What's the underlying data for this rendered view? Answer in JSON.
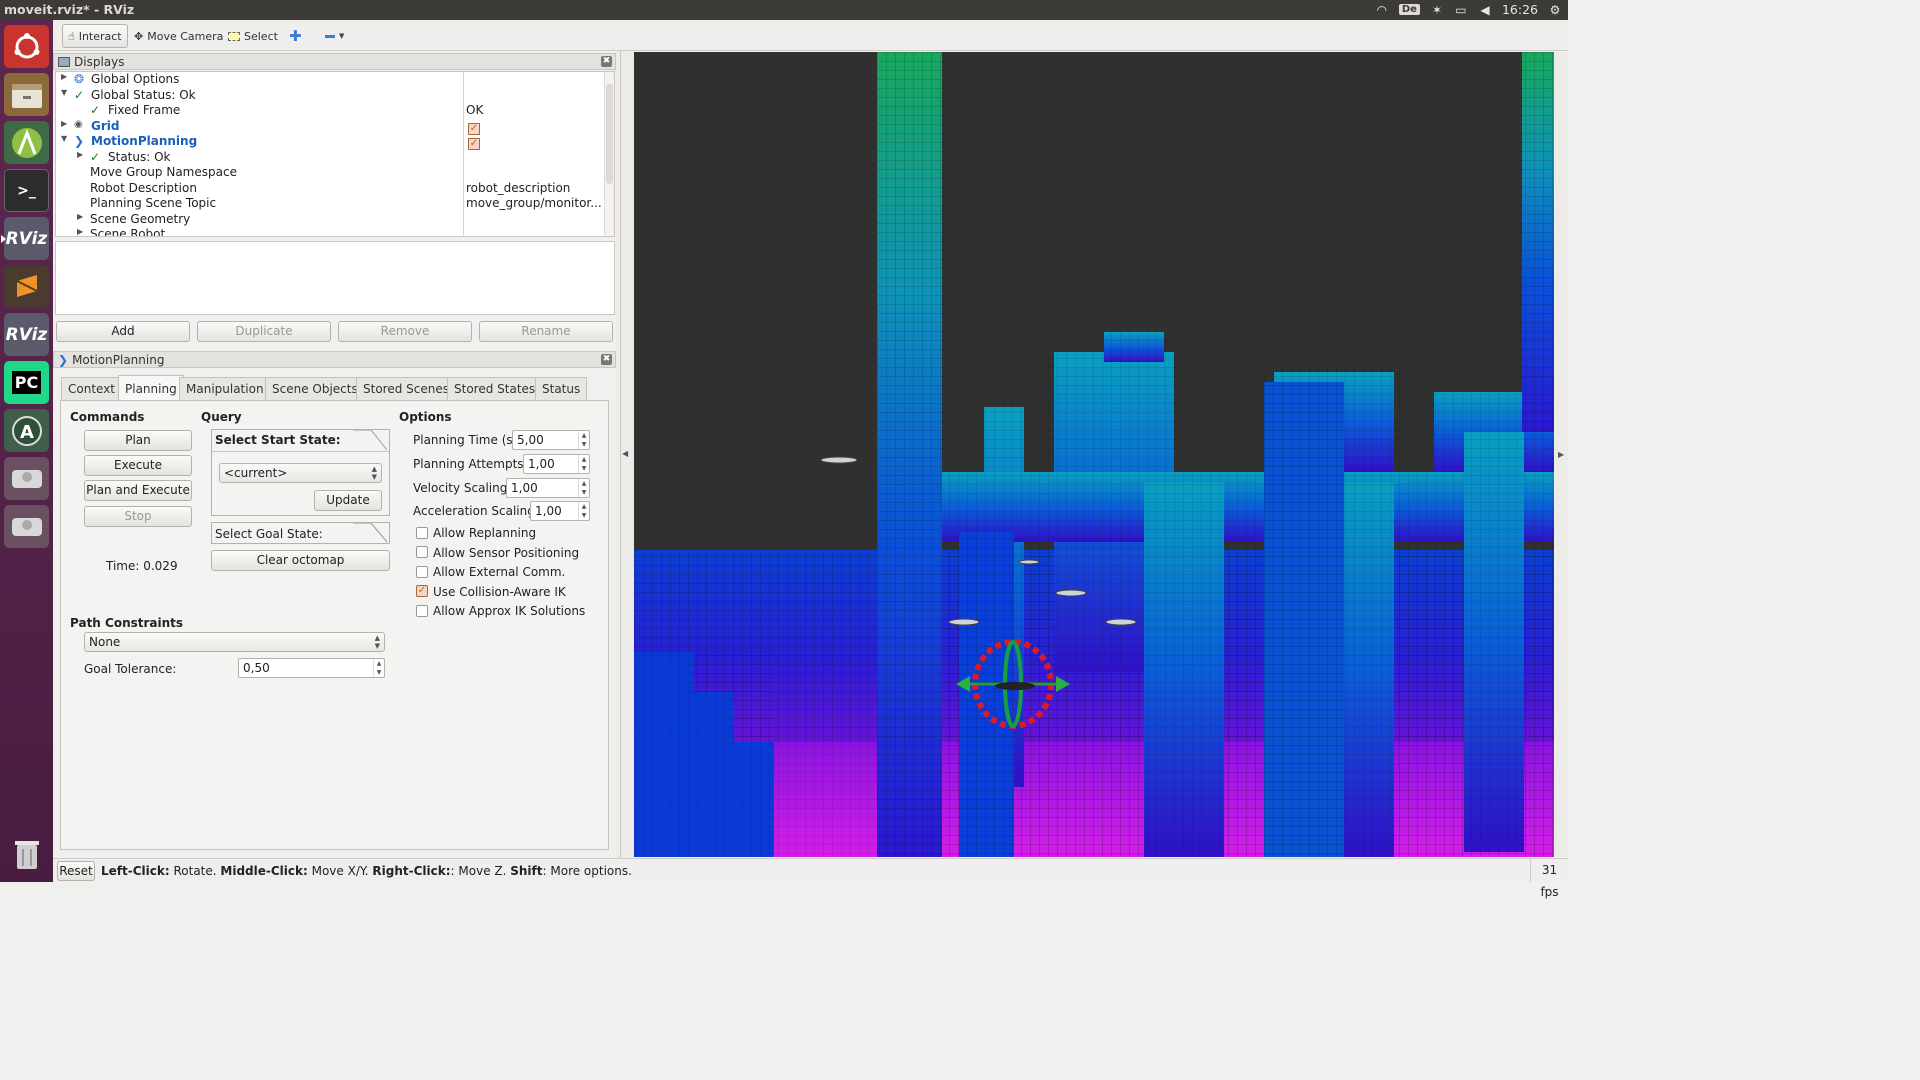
{
  "window_title": "moveit.rviz* - RViz",
  "tray": {
    "keyboard": "De",
    "time": "16:26",
    "icons": [
      "wifi-icon",
      "keyboard-layout-icon",
      "bluetooth-icon",
      "battery-icon",
      "volume-icon",
      "time",
      "settings-icon"
    ]
  },
  "launcher": [
    {
      "name": "ubuntu-dash-icon",
      "label": ""
    },
    {
      "name": "files-icon",
      "label": ""
    },
    {
      "name": "android-studio-icon",
      "label": ""
    },
    {
      "name": "terminal-icon",
      "label": ">_"
    },
    {
      "name": "rviz-icon",
      "label": "RViz"
    },
    {
      "name": "sublime-icon",
      "label": ""
    },
    {
      "name": "rviz-icon-2",
      "label": "RViz"
    },
    {
      "name": "pycharm-icon",
      "label": "PC"
    },
    {
      "name": "software-updater-icon",
      "label": "A"
    },
    {
      "name": "drive-icon",
      "label": ""
    },
    {
      "name": "drive-icon-2",
      "label": ""
    },
    {
      "name": "trash-icon",
      "label": ""
    }
  ],
  "toolbar": {
    "interact": "Interact",
    "move_camera": "Move Camera",
    "select": "Select"
  },
  "displays": {
    "title": "Displays",
    "rows": [
      {
        "label": "Global Options",
        "value": ""
      },
      {
        "label": "Global Status: Ok",
        "value": ""
      },
      {
        "label": "Fixed Frame",
        "value": "OK"
      },
      {
        "label": "Grid",
        "value": ""
      },
      {
        "label": "MotionPlanning",
        "value": ""
      },
      {
        "label": "Status: Ok",
        "value": ""
      },
      {
        "label": "Move Group Namespace",
        "value": ""
      },
      {
        "label": "Robot Description",
        "value": "robot_description"
      },
      {
        "label": "Planning Scene Topic",
        "value": "move_group/monitor..."
      },
      {
        "label": "Scene Geometry",
        "value": ""
      },
      {
        "label": "Scene Robot",
        "value": ""
      }
    ],
    "buttons": {
      "add": "Add",
      "duplicate": "Duplicate",
      "remove": "Remove",
      "rename": "Rename"
    }
  },
  "motion_planning": {
    "title": "MotionPlanning",
    "tabs": [
      "Context",
      "Planning",
      "Manipulation",
      "Scene Objects",
      "Stored Scenes",
      "Stored States",
      "Status"
    ],
    "selected_tab": "Planning",
    "commands": {
      "heading": "Commands",
      "plan": "Plan",
      "execute": "Execute",
      "plan_and_execute": "Plan and Execute",
      "stop": "Stop",
      "time": "Time: 0.029"
    },
    "query": {
      "heading": "Query",
      "start_state_label": "Select Start State:",
      "start_state_value": "<current>",
      "update": "Update",
      "goal_state_label": "Select Goal State:",
      "clear_octomap": "Clear octomap"
    },
    "options": {
      "heading": "Options",
      "planning_time_label": "Planning Time (s):",
      "planning_time": "5,00",
      "planning_attempts_label": "Planning Attempts:",
      "planning_attempts": "1,00",
      "velocity_scaling_label": "Velocity Scaling:",
      "velocity_scaling": "1,00",
      "acceleration_scaling_label": "Acceleration Scaling:",
      "acceleration_scaling": "1,00",
      "checkboxes": [
        {
          "label": "Allow Replanning",
          "checked": false
        },
        {
          "label": "Allow Sensor Positioning",
          "checked": false
        },
        {
          "label": "Allow External Comm.",
          "checked": false
        },
        {
          "label": "Use Collision-Aware IK",
          "checked": true
        },
        {
          "label": "Allow Approx IK Solutions",
          "checked": false
        }
      ]
    },
    "path_constraints": {
      "heading": "Path Constraints",
      "value": "None",
      "goal_tolerance_label": "Goal Tolerance:",
      "goal_tolerance": "0,50"
    }
  },
  "statusbar": {
    "reset": "Reset",
    "hint_parts": [
      {
        "text": "Left-Click:",
        "bold": true
      },
      {
        "text": " Rotate. ",
        "bold": false
      },
      {
        "text": "Middle-Click:",
        "bold": true
      },
      {
        "text": " Move X/Y. ",
        "bold": false
      },
      {
        "text": "Right-Click:",
        "bold": true
      },
      {
        "text": ": Move Z. ",
        "bold": false
      },
      {
        "text": "Shift",
        "bold": true
      },
      {
        "text": ": More options.",
        "bold": false
      }
    ],
    "fps": "31 fps"
  },
  "colors": {
    "launcher": "#5e2750",
    "topbar": "#3c3b37",
    "checkbox_accent": "#d35a1c",
    "link_blue": "#1c5fb8",
    "voxel_top": "#1aa86a",
    "voxel_mid": "#0a5fd6",
    "voxel_floor": "#c21fe0"
  }
}
